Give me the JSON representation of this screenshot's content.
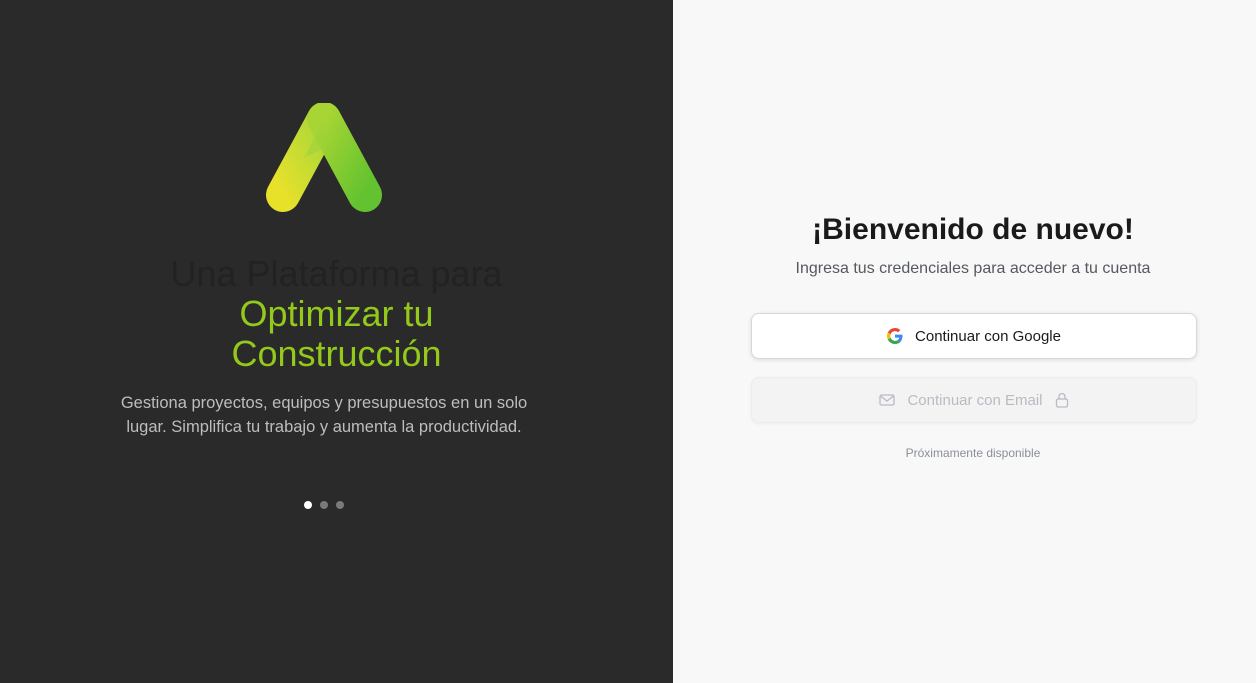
{
  "hero": {
    "headline_line1": "Una Plataforma para",
    "headline_line2": "Optimizar tu",
    "headline_line3": "Construcción",
    "description": "Gestiona proyectos, equipos y presupuestos en un solo lugar. Simplifica tu trabajo y aumenta la productividad.",
    "carousel": {
      "count": 3,
      "active_index": 0
    }
  },
  "login": {
    "title": "¡Bienvenido de nuevo!",
    "subtitle": "Ingresa tus credenciales para acceder a tu cuenta",
    "google_button_label": "Continuar con Google",
    "email_button_label": "Continuar con Email",
    "email_note": "Próximamente disponible"
  },
  "colors": {
    "left_bg": "#2a2a2a",
    "right_bg": "#f8f8f8",
    "accent": "#93c91a"
  },
  "icons": {
    "logo": "brand-logo",
    "google": "google-icon",
    "email": "mail-icon",
    "lock": "lock-icon"
  }
}
